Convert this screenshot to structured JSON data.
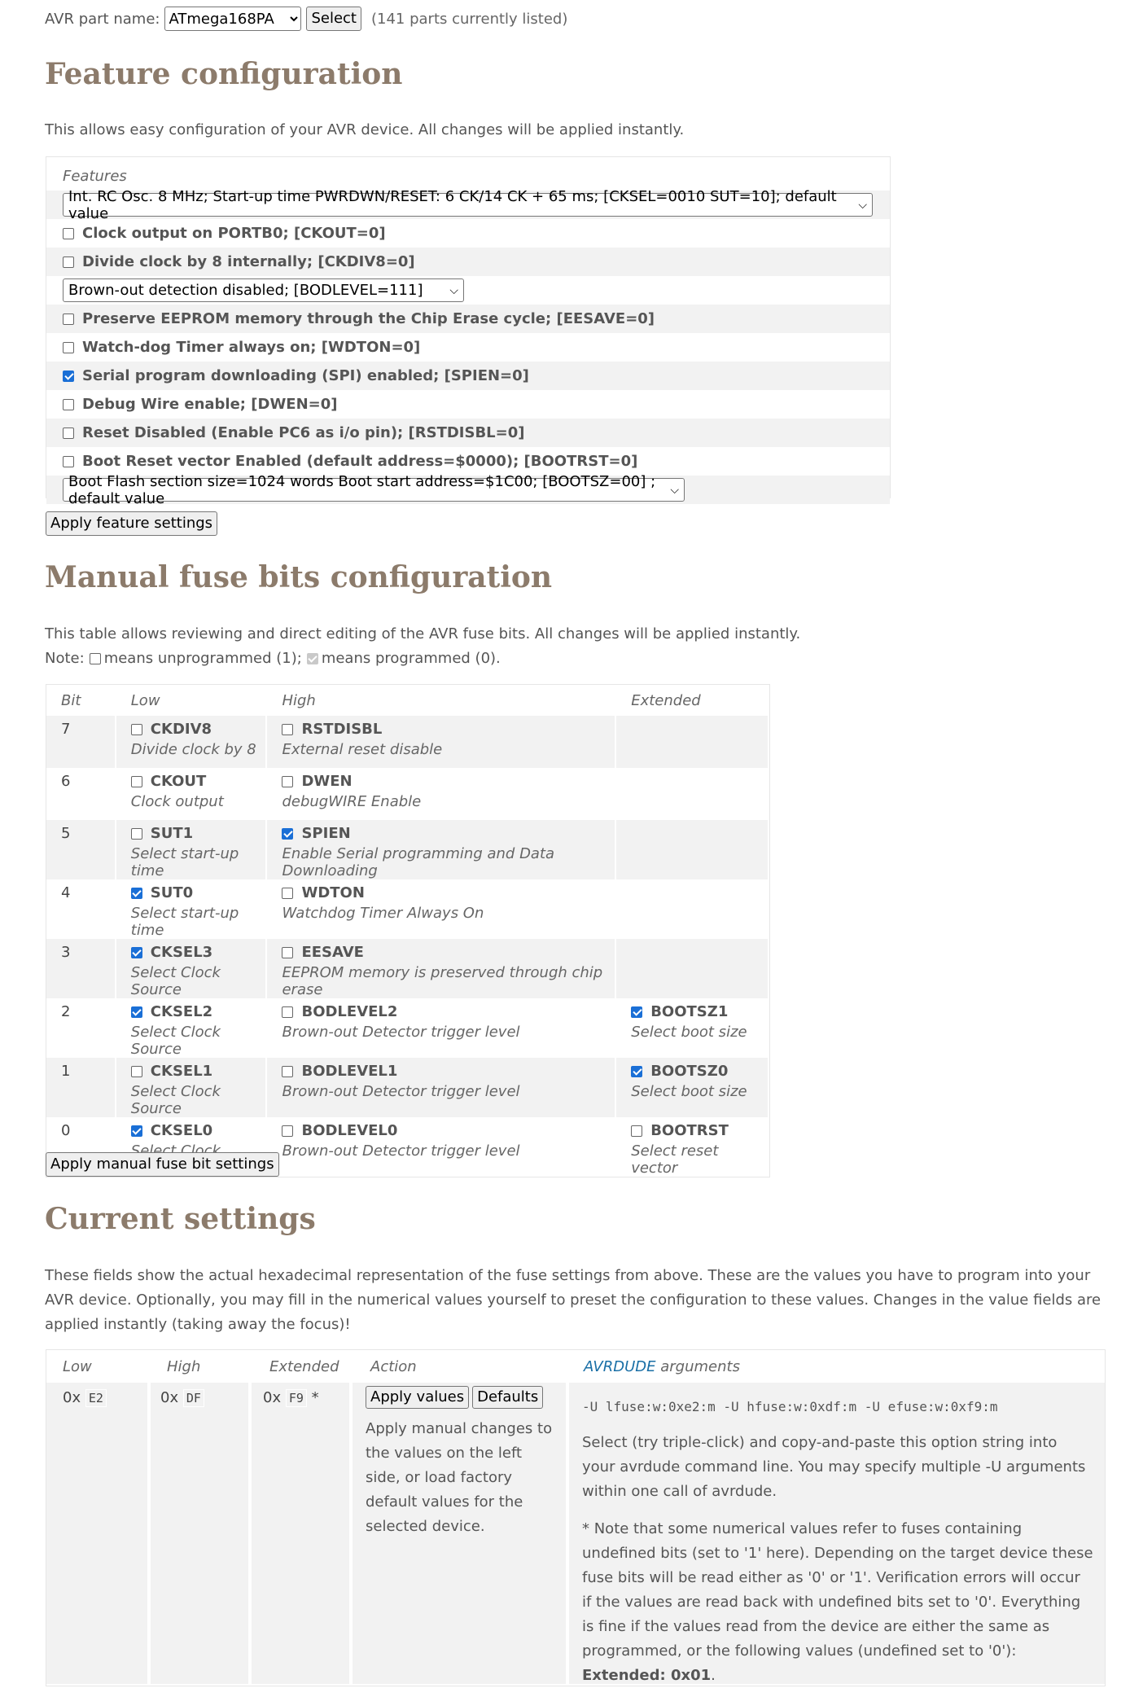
{
  "part": {
    "label": "AVR part name:",
    "selected": "ATmega168PA",
    "select_button": "Select",
    "count_text": "(141 parts currently listed)"
  },
  "feature": {
    "title": "Feature configuration",
    "desc": "This allows easy configuration of your AVR device. All changes will be applied instantly.",
    "header": "Features",
    "osc_select": "Int. RC Osc. 8 MHz; Start-up time PWRDWN/RESET: 6 CK/14 CK + 65 ms; [CKSEL=0010 SUT=10]; default value",
    "ckout": "Clock output on PORTB0; [CKOUT=0]",
    "ckdiv8": "Divide clock by 8 internally; [CKDIV8=0]",
    "bod_select": "Brown-out detection disabled; [BODLEVEL=111]",
    "eesave": "Preserve EEPROM memory through the Chip Erase cycle; [EESAVE=0]",
    "wdton": "Watch-dog Timer always on; [WDTON=0]",
    "spien": "Serial program downloading (SPI) enabled; [SPIEN=0]",
    "dwen": "Debug Wire enable; [DWEN=0]",
    "rstdisbl": "Reset Disabled (Enable PC6 as i/o pin); [RSTDISBL=0]",
    "bootrst": "Boot Reset vector Enabled (default address=$0000); [BOOTRST=0]",
    "bootsz_select": "Boot Flash section size=1024 words Boot start address=$1C00; [BOOTSZ=00] ; default value",
    "apply_button": "Apply feature settings"
  },
  "manual": {
    "title": "Manual fuse bits configuration",
    "desc": "This table allows reviewing and direct editing of the AVR fuse bits. All changes will be applied instantly.",
    "note_prefix": "Note:",
    "note_unprog": "means unprogrammed (1);",
    "note_prog": "means programmed (0).",
    "headers": {
      "bit": "Bit",
      "low": "Low",
      "high": "High",
      "ext": "Extended"
    },
    "rows": [
      {
        "bit": "7",
        "low": {
          "name": "CKDIV8",
          "desc": "Divide clock by 8"
        },
        "high": {
          "name": "RSTDISBL",
          "desc": "External reset disable"
        }
      },
      {
        "bit": "6",
        "low": {
          "name": "CKOUT",
          "desc": "Clock output"
        },
        "high": {
          "name": "DWEN",
          "desc": "debugWIRE Enable"
        }
      },
      {
        "bit": "5",
        "low": {
          "name": "SUT1",
          "desc": "Select start-up time"
        },
        "high": {
          "name": "SPIEN",
          "desc": "Enable Serial programming and Data Downloading"
        }
      },
      {
        "bit": "4",
        "low": {
          "name": "SUT0",
          "desc": "Select start-up time"
        },
        "high": {
          "name": "WDTON",
          "desc": "Watchdog Timer Always On"
        }
      },
      {
        "bit": "3",
        "low": {
          "name": "CKSEL3",
          "desc": "Select Clock Source"
        },
        "high": {
          "name": "EESAVE",
          "desc": "EEPROM memory is preserved through chip erase"
        }
      },
      {
        "bit": "2",
        "low": {
          "name": "CKSEL2",
          "desc": "Select Clock Source"
        },
        "high": {
          "name": "BODLEVEL2",
          "desc": "Brown-out Detector trigger level"
        },
        "ext": {
          "name": "BOOTSZ1",
          "desc": "Select boot size"
        }
      },
      {
        "bit": "1",
        "low": {
          "name": "CKSEL1",
          "desc": "Select Clock Source"
        },
        "high": {
          "name": "BODLEVEL1",
          "desc": "Brown-out Detector trigger level"
        },
        "ext": {
          "name": "BOOTSZ0",
          "desc": "Select boot size"
        }
      },
      {
        "bit": "0",
        "low": {
          "name": "CKSEL0",
          "desc": "Select Clock Source"
        },
        "high": {
          "name": "BODLEVEL0",
          "desc": "Brown-out Detector trigger level"
        },
        "ext": {
          "name": "BOOTRST",
          "desc": "Select reset vector"
        }
      }
    ],
    "apply_button": "Apply manual fuse bit settings"
  },
  "current": {
    "title": "Current settings",
    "desc": "These fields show the actual hexadecimal representation of the fuse settings from above. These are the values you have to program into your AVR device. Optionally, you may fill in the numerical values yourself to preset the configuration to these values. Changes in the value fields are applied instantly (taking away the focus)!",
    "headers": {
      "low": "Low",
      "high": "High",
      "ext": "Extended",
      "action": "Action",
      "avrdude_link": "AVRDUDE",
      "avrdude_rest": "arguments"
    },
    "prefix": "0x",
    "low": "E2",
    "high": "DF",
    "ext": "F9",
    "ext_mark": "*",
    "apply_values": "Apply values",
    "defaults": "Defaults",
    "action_desc": "Apply manual changes to the values on the left side, or load factory default values for the selected device.",
    "avrdude_args": "-U lfuse:w:0xe2:m -U hfuse:w:0xdf:m -U efuse:w:0xf9:m",
    "copy_hint": "Select (try triple-click) and copy-and-paste this option string into your avrdude command line. You may specify multiple -U arguments within one call of avrdude.",
    "note": "* Note that some numerical values refer to fuses containing undefined bits (set to '1' here). Depending on the target device these fuse bits will be read either as '0' or '1'. Verification errors will occur if the values are read back with undefined bits set to '0'. Everything is fine if the values read from the device are either the same as programmed, or the following values (undefined set to '0'):",
    "note_bold": "Extended: 0x01",
    "note_end": "."
  },
  "colors": {
    "heading": "#8c7b6b",
    "checkbox_on": "#1a6fd6",
    "link": "#1a6fa6",
    "stripe": "#f2f2f2"
  }
}
